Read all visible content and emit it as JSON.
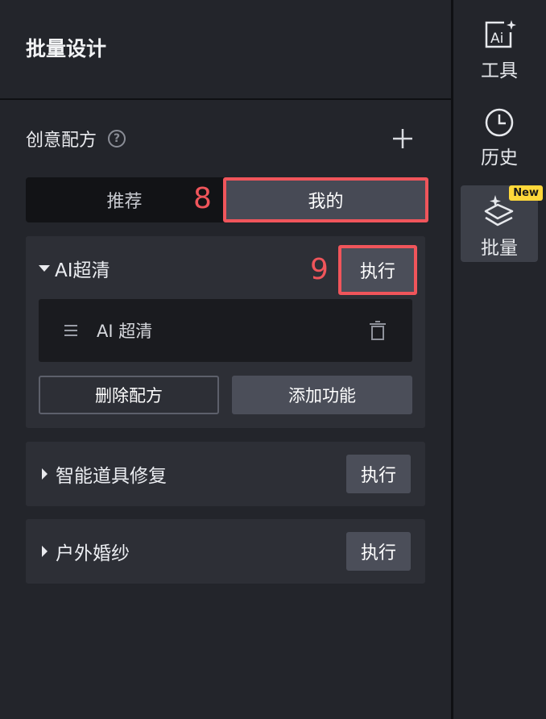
{
  "panel": {
    "title": "批量设计",
    "section_title": "创意配方",
    "help_icon": "help-circle-icon",
    "add_icon": "plus-icon"
  },
  "tabs": [
    {
      "label": "推荐",
      "selected": false
    },
    {
      "label": "我的",
      "selected": true
    }
  ],
  "markers": {
    "tab": "8",
    "exec": "9"
  },
  "recipes": [
    {
      "title": "AI超清",
      "expanded": true,
      "exec_label": "执行",
      "features": [
        {
          "label": "AI 超清"
        }
      ],
      "delete_label": "删除配方",
      "add_label": "添加功能"
    },
    {
      "title": "智能道具修复",
      "expanded": false,
      "exec_label": "执行"
    },
    {
      "title": "户外婚纱",
      "expanded": false,
      "exec_label": "执行"
    }
  ],
  "sidebar": {
    "items": [
      {
        "label": "工具",
        "icon": "ai-image-icon"
      },
      {
        "label": "历史",
        "icon": "clock-icon"
      },
      {
        "label": "批量",
        "icon": "layers-sparkle-icon",
        "badge": "New",
        "active": true
      }
    ]
  },
  "colors": {
    "background": "#23252b",
    "highlight": "#f0555b",
    "badge": "#ffd83a"
  }
}
